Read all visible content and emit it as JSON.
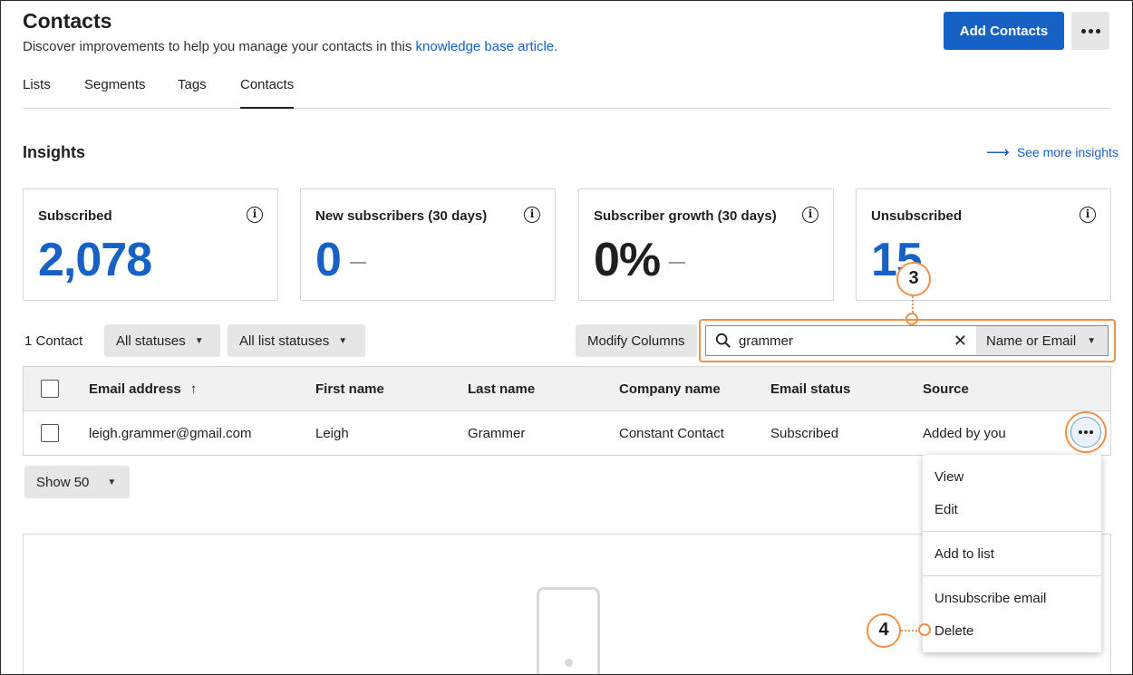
{
  "header": {
    "title": "Contacts",
    "description": "Discover improvements to help you manage your contacts in this ",
    "description_link": "knowledge base article.",
    "add_button": "Add Contacts"
  },
  "tabs": [
    {
      "label": "Lists"
    },
    {
      "label": "Segments"
    },
    {
      "label": "Tags"
    },
    {
      "label": "Contacts",
      "active": true
    }
  ],
  "insights": {
    "title": "Insights",
    "see_more": "See more insights",
    "cards": [
      {
        "label": "Subscribed",
        "value": "2,078"
      },
      {
        "label": "New subscribers (30 days)",
        "value": "0"
      },
      {
        "label": "Subscriber growth (30 days)",
        "value": "0%"
      },
      {
        "label": "Unsubscribed",
        "value": "15"
      }
    ]
  },
  "filters": {
    "count": "1 Contact",
    "status": "All statuses",
    "list_status": "All list statuses",
    "modify_columns": "Modify Columns",
    "search_value": "grammer",
    "search_type": "Name or Email"
  },
  "table": {
    "columns": [
      "Email address",
      "First name",
      "Last name",
      "Company name",
      "Email status",
      "Source"
    ],
    "rows": [
      [
        "leigh.grammer@gmail.com",
        "Leigh",
        "Grammer",
        "Constant Contact",
        "Subscribed",
        "Added by you"
      ]
    ]
  },
  "pagination": {
    "show": "Show 50"
  },
  "row_menu": {
    "items": [
      "View",
      "Edit",
      "Add to list",
      "Unsubscribe email",
      "Delete"
    ]
  },
  "callouts": {
    "search": "3",
    "delete": "4"
  },
  "colors": {
    "primary": "#1760c4",
    "callout": "#f0914a"
  }
}
